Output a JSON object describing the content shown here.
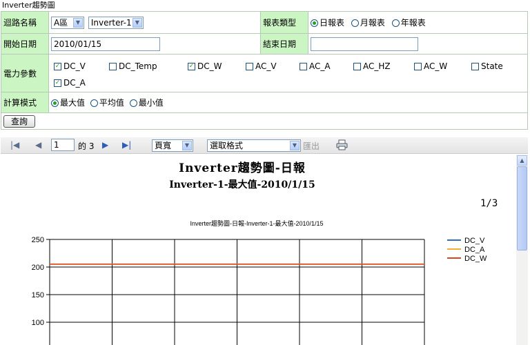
{
  "window": {
    "title": "Inverter趨勢圖"
  },
  "form": {
    "circuit_label": "迴路名稱",
    "area_value": "A區",
    "inverter_value": "Inverter-1",
    "report_type_label": "報表類型",
    "report_types": [
      "日報表",
      "月報表",
      "年報表"
    ],
    "report_type_selected": 0,
    "start_label": "開始日期",
    "start_value": "2010/01/15",
    "end_label": "結束日期",
    "end_value": "",
    "params_label": "電力參數",
    "params": [
      {
        "name": "DC_V",
        "checked": true
      },
      {
        "name": "DC_Temp",
        "checked": false
      },
      {
        "name": "DC_W",
        "checked": true
      },
      {
        "name": "AC_V",
        "checked": false
      },
      {
        "name": "AC_A",
        "checked": false
      },
      {
        "name": "AC_HZ",
        "checked": false
      },
      {
        "name": "AC_W",
        "checked": false
      },
      {
        "name": "State",
        "checked": false
      },
      {
        "name": "DC_A",
        "checked": true
      }
    ],
    "calc_label": "計算模式",
    "calc_modes": [
      "最大值",
      "平均值",
      "最小值"
    ],
    "calc_selected": 0,
    "query_label": "查詢"
  },
  "toolbar": {
    "page_current": "1",
    "page_total": "的 3",
    "zoom_value": "頁寬",
    "format_value": "選取格式",
    "export_label": "匯出"
  },
  "report": {
    "title": "Inverter趨勢圖-日報",
    "subtitle": "Inverter-1-最大值-2010/1/15",
    "page_indicator": "1/3"
  },
  "chart_data": {
    "type": "line",
    "title": "Inverter趨勢圖-日報-Inverter-1-最大值-2010/1/15",
    "y_ticks": [
      250,
      200,
      150,
      100
    ],
    "ylim": [
      50,
      250
    ],
    "grid": true,
    "legend_position": "right",
    "series": [
      {
        "name": "DC_V",
        "color": "#2e6fb7",
        "values": [
          205,
          205,
          205,
          205,
          205,
          205,
          205
        ]
      },
      {
        "name": "DC_A",
        "color": "#f0b030",
        "values": [
          205,
          205,
          205,
          205,
          205,
          205,
          205
        ]
      },
      {
        "name": "DC_W",
        "color": "#d8451e",
        "values": [
          205,
          205,
          205,
          205,
          205,
          205,
          205
        ]
      }
    ]
  }
}
